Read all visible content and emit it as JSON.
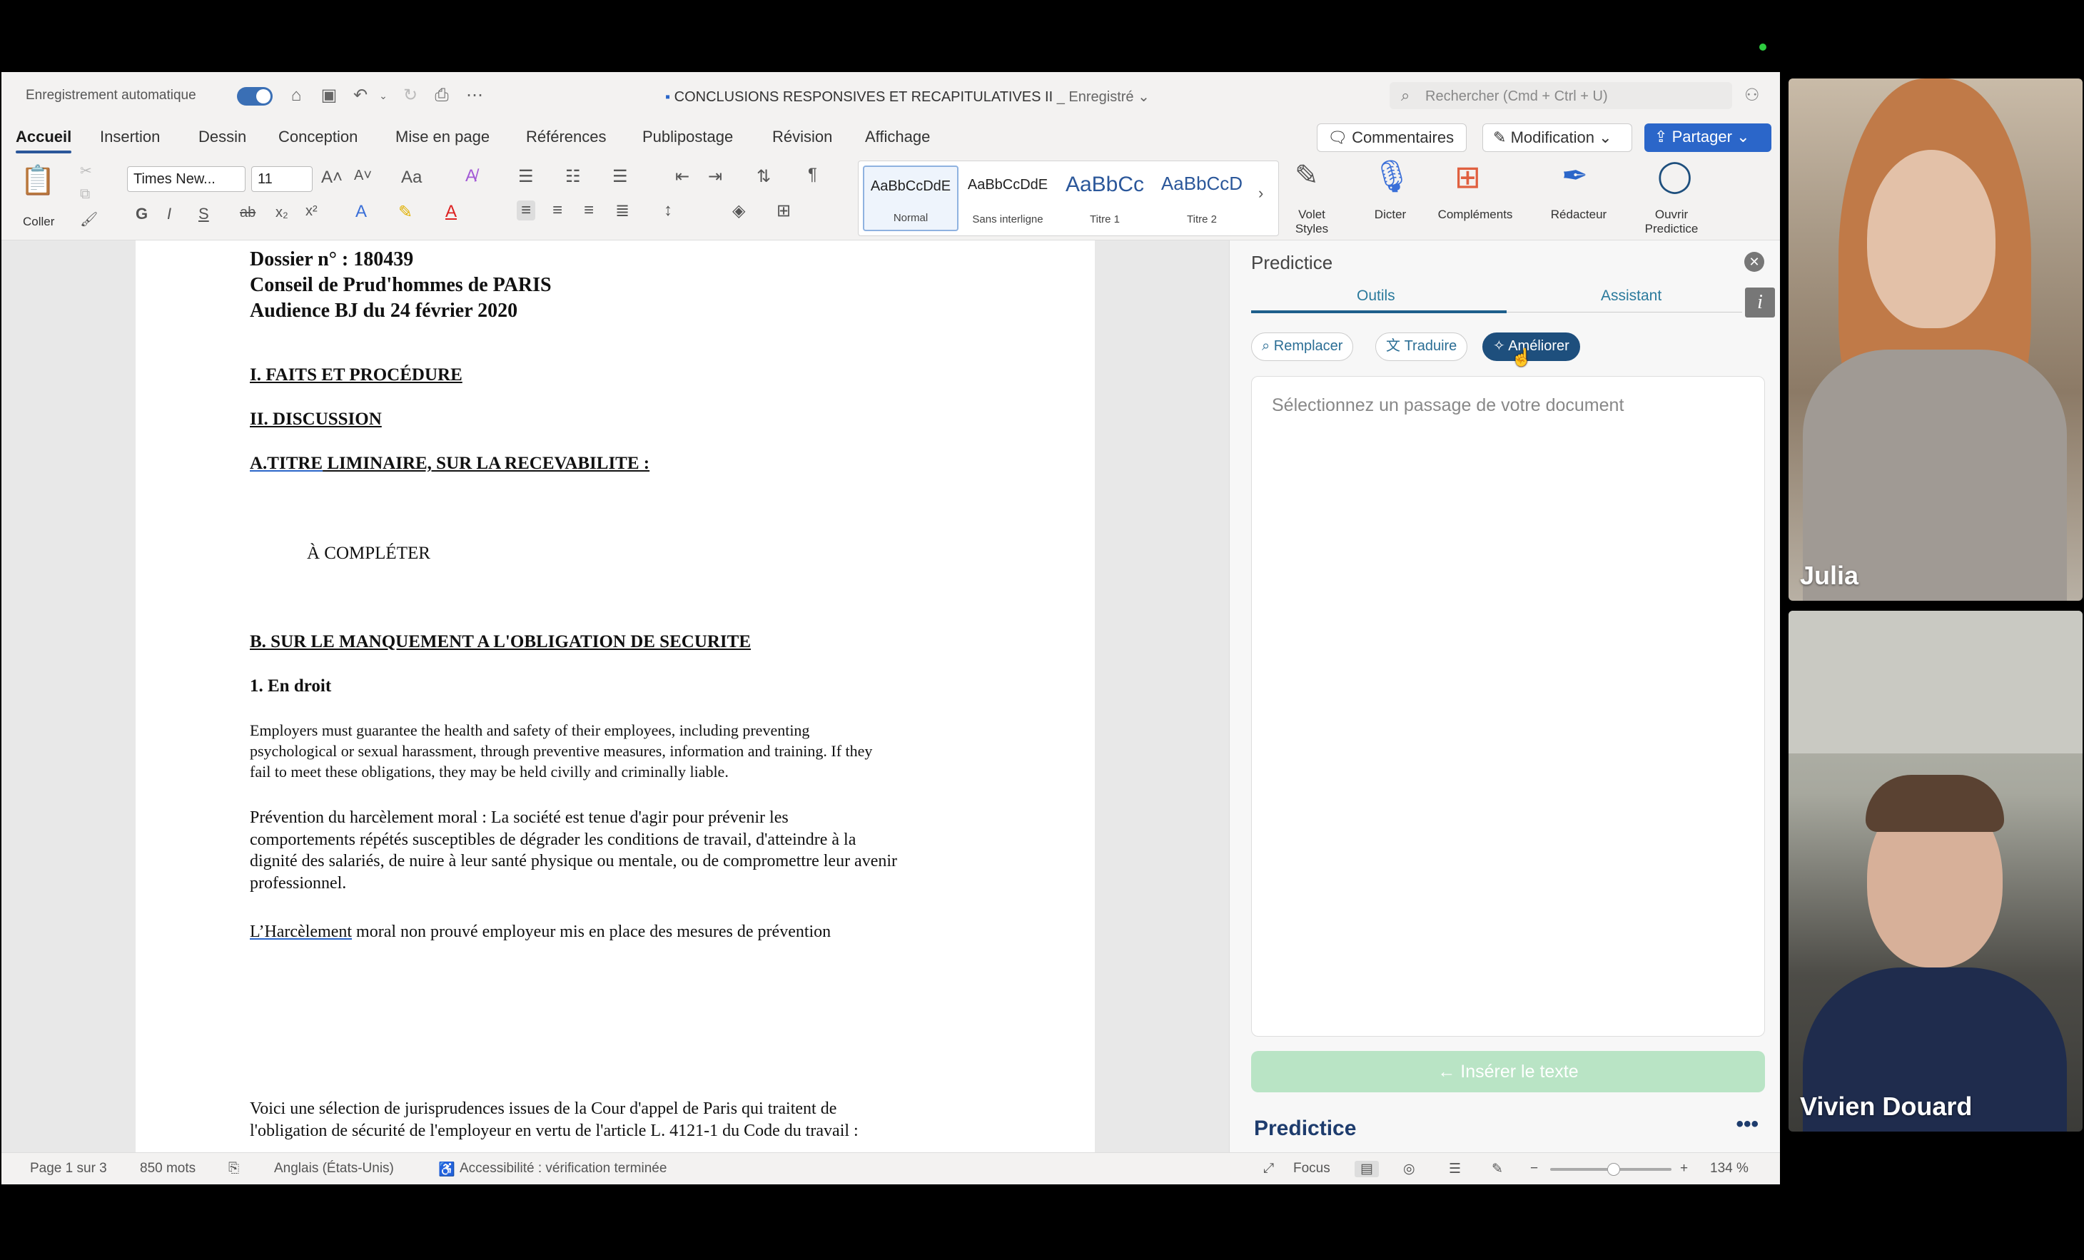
{
  "titlebar": {
    "autosave_label": "Enregistrement automatique",
    "doc_title": "CONCLUSIONS RESPONSIVES ET RECAPITULATIVES II",
    "doc_status": "_ Enregistré ⌄",
    "search_placeholder": "Rechercher (Cmd + Ctrl + U)"
  },
  "tabs": [
    "Accueil",
    "Insertion",
    "Dessin",
    "Conception",
    "Mise en page",
    "Références",
    "Publipostage",
    "Révision",
    "Affichage"
  ],
  "buttons": {
    "comments": "Commentaires",
    "modification": "Modification",
    "share": "Partager"
  },
  "ribbon": {
    "paste_label": "Coller",
    "font_name": "Times New...",
    "font_size": "11",
    "bold": "G",
    "italic": "I",
    "underline": "S",
    "styles": [
      {
        "preview": "AaBbCcDdE",
        "name": "Normal"
      },
      {
        "preview": "AaBbCcDdE",
        "name": "Sans interligne"
      },
      {
        "preview": "AaBbCc",
        "name": "Titre 1"
      },
      {
        "preview": "AaBbCcD",
        "name": "Titre 2"
      }
    ],
    "volet_styles": "Volet Styles",
    "dicter": "Dicter",
    "complements": "Compléments",
    "redacteur": "Rédacteur",
    "ouvrir_predictice": "Ouvrir Predictice"
  },
  "document": {
    "line1": "Dossier n° : 180439",
    "line2": "Conseil de Prud'hommes de PARIS",
    "line3": "Audience BJ du 24 février 2020",
    "h_faits": "I. FAITS ET PROCÉDURE",
    "h_discussion": "II. DISCUSSION",
    "h_a_prefix": "A.TITRE",
    "h_a_rest": " LIMINAIRE, SUR LA RECEVABILITE :",
    "a_completer": "À COMPLÉTER",
    "h_b": "B. SUR LE MANQUEMENT A L'OBLIGATION DE SECURITE",
    "h_en_droit": "1. En droit",
    "para_en_1": "Employers must guarantee the health and safety of their employees, including preventing",
    "para_en_2": "psychological or sexual harassment, through preventive measures, information and training. If they",
    "para_en_3": "fail to meet these obligations, they may be held civilly and criminally liable.",
    "para_fr_1": "Prévention du harcèlement moral : La société est tenue d'agir pour prévenir les",
    "para_fr_2": "comportements répétés susceptibles de dégrader les conditions de travail, d'atteindre à la",
    "para_fr_3": "dignité des salariés, de nuire à leur santé physique ou mentale, ou de compromettre leur avenir",
    "para_fr_4": "professionnel.",
    "harc_word": "L’Harcèlement",
    "harc_rest": " moral non prouvé employeur mis en place des mesures de prévention",
    "juris_1": "Voici une sélection de jurisprudences issues de la Cour d'appel de Paris qui traitent de",
    "juris_2": "l'obligation de sécurité de l'employeur en vertu de l'article L. 4121-1 du Code du travail :"
  },
  "predictice": {
    "title": "Predictice",
    "tab_tools": "Outils",
    "tab_assistant": "Assistant",
    "info": "i",
    "btn_replace": "Remplacer",
    "btn_translate": "Traduire",
    "btn_improve": "Améliorer",
    "placeholder": "Sélectionnez un passage de votre document",
    "insert": "←  Insérer le texte",
    "brand": "Predictice",
    "more": "•••"
  },
  "status": {
    "page": "Page 1 sur 3",
    "words": "850 mots",
    "language": "Anglais (États-Unis)",
    "accessibility": "Accessibilité : vérification terminée",
    "focus": "Focus",
    "zoom": "134 %"
  },
  "participants": [
    {
      "name": "Julia"
    },
    {
      "name": "Vivien Douard"
    }
  ],
  "colors": {
    "accent": "#2b66c9",
    "predictice_navy": "#1e4f7d",
    "insert_btn": "#b9e4c5"
  }
}
